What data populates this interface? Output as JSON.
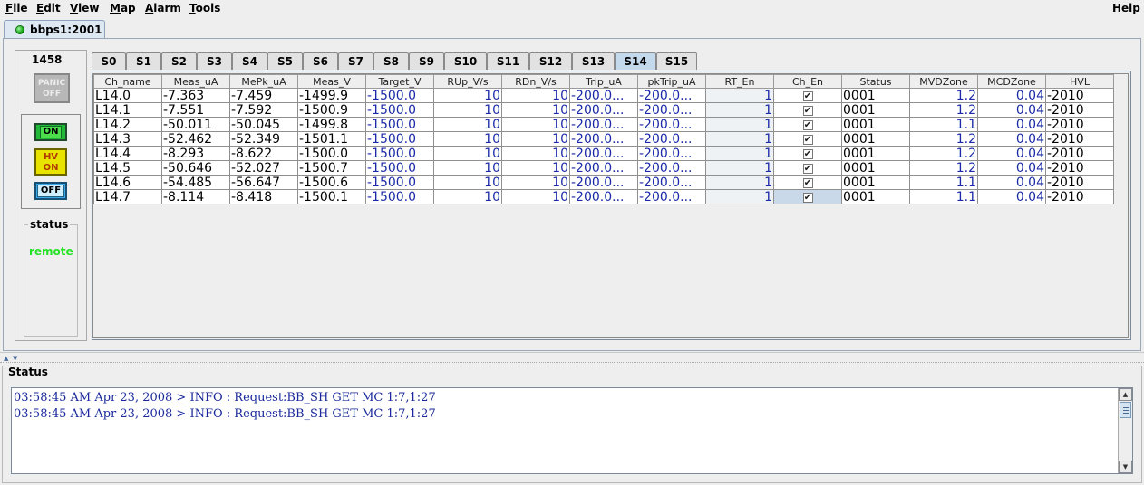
{
  "menu": {
    "items": [
      {
        "mnemonic": "F",
        "rest": "ile"
      },
      {
        "mnemonic": "E",
        "rest": "dit"
      },
      {
        "mnemonic": "V",
        "rest": "iew"
      },
      {
        "mnemonic": "M",
        "rest": "ap"
      },
      {
        "mnemonic": "A",
        "rest": "larm"
      },
      {
        "mnemonic": "T",
        "rest": "ools"
      }
    ],
    "help": "Help"
  },
  "connection": {
    "label": "bbps1:2001",
    "status_color": "#0a9a0a",
    "icon": "status-led-icon"
  },
  "control": {
    "crate_id": "1458",
    "panic": {
      "line1": "PANIC",
      "line2": "OFF"
    },
    "on": "ON",
    "hv_on": {
      "line1": "HV",
      "line2": "ON"
    },
    "off": "OFF",
    "status_title": "status",
    "status_value": "remote",
    "status_color": "#25e225"
  },
  "tabs": {
    "active": "S14",
    "items": [
      "S0",
      "S1",
      "S2",
      "S3",
      "S4",
      "S5",
      "S6",
      "S7",
      "S8",
      "S9",
      "S10",
      "S11",
      "S12",
      "S13",
      "S14",
      "S15"
    ]
  },
  "table": {
    "headers": [
      "Ch_name",
      "Meas_uA",
      "MePk_uA",
      "Meas_V",
      "Target_V",
      "RUp_V/s",
      "RDn_V/s",
      "Trip_uA",
      "pkTrip_uA",
      "RT_En",
      "Ch_En",
      "Status",
      "MVDZone",
      "MCDZone",
      "HVL"
    ],
    "rows": [
      [
        "L14.0",
        "-7.363",
        "-7.459",
        "-1499.9",
        "-1500.0",
        "10",
        "10",
        "-200.0...",
        "-200.0...",
        "1",
        "✔",
        "0001",
        "1.2",
        "0.04",
        "-2010"
      ],
      [
        "L14.1",
        "-7.551",
        "-7.592",
        "-1500.9",
        "-1500.0",
        "10",
        "10",
        "-200.0...",
        "-200.0...",
        "1",
        "✔",
        "0001",
        "1.2",
        "0.04",
        "-2010"
      ],
      [
        "L14.2",
        "-50.011",
        "-50.045",
        "-1499.8",
        "-1500.0",
        "10",
        "10",
        "-200.0...",
        "-200.0...",
        "1",
        "✔",
        "0001",
        "1.1",
        "0.04",
        "-2010"
      ],
      [
        "L14.3",
        "-52.462",
        "-52.349",
        "-1501.1",
        "-1500.0",
        "10",
        "10",
        "-200.0...",
        "-200.0...",
        "1",
        "✔",
        "0001",
        "1.2",
        "0.04",
        "-2010"
      ],
      [
        "L14.4",
        "-8.293",
        "-8.622",
        "-1500.0",
        "-1500.0",
        "10",
        "10",
        "-200.0...",
        "-200.0...",
        "1",
        "✔",
        "0001",
        "1.2",
        "0.04",
        "-2010"
      ],
      [
        "L14.5",
        "-50.646",
        "-52.027",
        "-1500.7",
        "-1500.0",
        "10",
        "10",
        "-200.0...",
        "-200.0...",
        "1",
        "✔",
        "0001",
        "1.2",
        "0.04",
        "-2010"
      ],
      [
        "L14.6",
        "-54.485",
        "-56.647",
        "-1500.6",
        "-1500.0",
        "10",
        "10",
        "-200.0...",
        "-200.0...",
        "1",
        "✔",
        "0001",
        "1.1",
        "0.04",
        "-2010"
      ],
      [
        "L14.7",
        "-8.114",
        "-8.418",
        "-1500.1",
        "-1500.0",
        "10",
        "10",
        "-200.0...",
        "-200.0...",
        "1",
        "✔",
        "0001",
        "1.1",
        "0.04",
        "-2010"
      ]
    ]
  },
  "status_panel": {
    "title": "Status",
    "log": [
      "03:58:45 AM Apr 23, 2008 > INFO : Request:BB_SH GET MC 1:7,1:27",
      "03:58:45 AM Apr 23, 2008 > INFO : Request:BB_SH GET MC 1:7,1:27"
    ]
  }
}
